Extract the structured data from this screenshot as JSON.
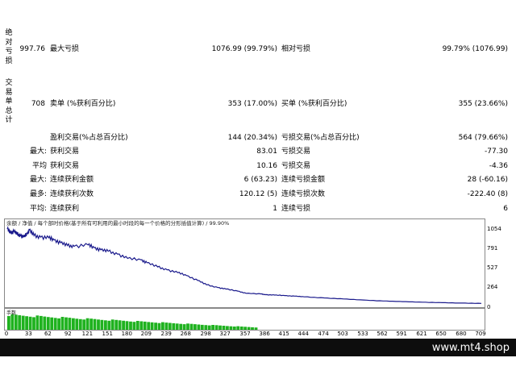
{
  "sections": {
    "absolute_dd_label": "绝对亏损",
    "trades_summary_label": "交易单总计"
  },
  "row1": {
    "value": "997.76",
    "max_dd_label": "最大亏损",
    "max_dd_value": "1076.99 (99.79%)",
    "rel_dd_label": "相对亏损",
    "rel_dd_value": "99.79% (1076.99)"
  },
  "row2": {
    "value": "708",
    "short_label": "卖单 (%获利百分比)",
    "short_value": "353 (17.00%)",
    "long_label": "买单 (%获利百分比)",
    "long_value": "355 (23.66%)"
  },
  "rows": [
    {
      "prefix": "",
      "l_label": "盈利交易(%占总百分比)",
      "l_value": "144 (20.34%)",
      "r_label": "亏损交易(%占总百分比)",
      "r_value": "564 (79.66%)"
    },
    {
      "prefix": "最大:",
      "l_label": "获利交易",
      "l_value": "83.01",
      "r_label": "亏损交易",
      "r_value": "-77.30"
    },
    {
      "prefix": "平均",
      "l_label": "获利交易",
      "l_value": "10.16",
      "r_label": "亏损交易",
      "r_value": "-4.36"
    },
    {
      "prefix": "最大:",
      "l_label": "连续获利金额",
      "l_value": "6 (63.23)",
      "r_label": "连续亏损金额",
      "r_value": "28 (-60.16)"
    },
    {
      "prefix": "最多:",
      "l_label": "连续获利次数",
      "l_value": "120.12 (5)",
      "r_label": "连续亏损次数",
      "r_value": "-222.40 (8)"
    },
    {
      "prefix": "平均:",
      "l_label": "连续获利",
      "l_value": "1",
      "r_label": "连续亏损",
      "r_value": "6"
    }
  ],
  "chart": {
    "header": "余额 / 净值 / 每个部时价格(基于所有可利用的最小时段的每一个价格的分形插值计算) / 99.90%",
    "volume_label": "手数"
  },
  "chart_data": {
    "type": "line",
    "series": [
      {
        "x": [
          0,
          5,
          10,
          15,
          20,
          25,
          30,
          33,
          40,
          50,
          62,
          70,
          80,
          90,
          100,
          121,
          130,
          140,
          151,
          165,
          180,
          200,
          209,
          225,
          239,
          255,
          268,
          285,
          298,
          315,
          327,
          345,
          357,
          380,
          386,
          400,
          415,
          430,
          444,
          474,
          503,
          533,
          562,
          591,
          621,
          650,
          680,
          709
        ],
        "values": [
          1054,
          1000,
          1020,
          980,
          960,
          940,
          990,
          1040,
          960,
          940,
          930,
          900,
          860,
          820,
          810,
          830,
          790,
          760,
          740,
          700,
          640,
          620,
          580,
          520,
          480,
          440,
          400,
          330,
          270,
          230,
          210,
          180,
          150,
          140,
          130,
          125,
          118,
          110,
          100,
          85,
          70,
          55,
          42,
          33,
          25,
          18,
          12,
          8
        ]
      }
    ],
    "yticks": [
      "1054",
      "791",
      "527",
      "264",
      "0"
    ],
    "ylim": [
      0,
      1054
    ],
    "xticks": [
      "0",
      "33",
      "62",
      "92",
      "121",
      "151",
      "180",
      "209",
      "239",
      "268",
      "298",
      "327",
      "357",
      "386",
      "415",
      "444",
      "474",
      "503",
      "533",
      "562",
      "591",
      "621",
      "650",
      "680",
      "709"
    ],
    "xlim": [
      0,
      709
    ],
    "volume": {
      "x_end": 375,
      "max": 1
    }
  },
  "colors": {
    "balance_line": "#1a1a8c",
    "volume_bar": "#1fb21f",
    "footer_bg": "#0d0d0d"
  },
  "footer": {
    "site": "www.mt4.shop"
  }
}
